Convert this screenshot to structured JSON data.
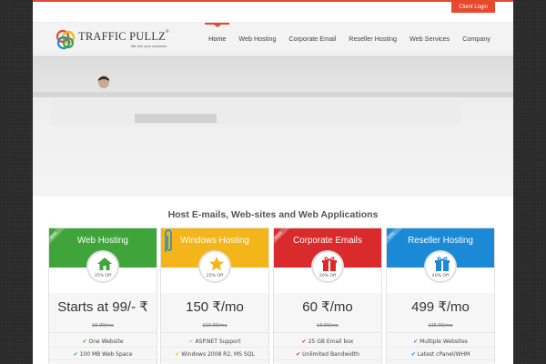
{
  "topbar": {
    "client_login": "Client Login"
  },
  "brand": {
    "name": "TRAFFIC PULLZ",
    "reg": "®",
    "tagline": "We link your business"
  },
  "nav": {
    "items": [
      {
        "label": "Home",
        "active": true
      },
      {
        "label": "Web Hosting"
      },
      {
        "label": "Corporate Email"
      },
      {
        "label": "Reseller Hosting"
      },
      {
        "label": "Web Services"
      },
      {
        "label": "Company"
      }
    ]
  },
  "main": {
    "tagline": "Host E-mails, Web-sites and Web Applications"
  },
  "plans": [
    {
      "title": "Web Hosting",
      "ribbon": "NEW",
      "color": "#3fa53a",
      "icon": "home-icon",
      "discount": "35% Off",
      "price": "Starts at 99/- ₹",
      "old_price": "$5.99/mo",
      "features": [
        "One Website",
        "100 MB Web Space"
      ],
      "feature_icon_color": "#3fa53a"
    },
    {
      "title": "Windows Hosting",
      "ribbon": "",
      "color": "#f3b51a",
      "icon": "star-icon",
      "discount": "25% Off",
      "price": "150 ₹/mo",
      "old_price": "$10.99/mo",
      "features": [
        "ASP.NET Support",
        "Windows 2008 R2, MS SQL"
      ],
      "feature_icon_color": "#f3b51a"
    },
    {
      "title": "Corporate Emails",
      "ribbon": "SAVE",
      "color": "#d92b2b",
      "icon": "gift-icon",
      "discount": "20% Off",
      "price": "60 ₹/mo",
      "old_price": "$3.99/mo",
      "features": [
        "25 GB Email box",
        "Unlimited Bandwidth"
      ],
      "feature_icon_color": "#d92b2b"
    },
    {
      "title": "Reseller Hosting",
      "ribbon": "50%",
      "color": "#1a8ad6",
      "icon": "gift-icon",
      "discount": "40% Off",
      "price": "499 ₹/mo",
      "old_price": "$15.99/mo",
      "features": [
        "Multiple Websites",
        "Latest cPanel/WHM"
      ],
      "feature_icon_color": "#1a8ad6"
    }
  ]
}
